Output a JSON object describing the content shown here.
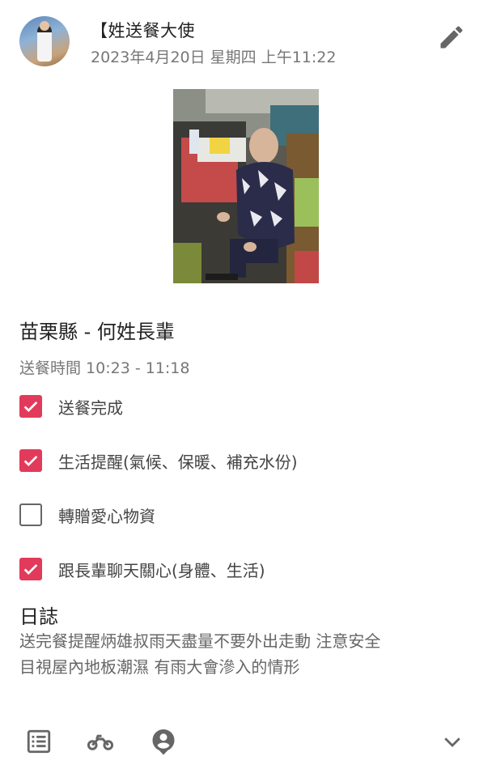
{
  "post": {
    "poster_name": "【姓送餐大使",
    "timestamp": "2023年4月20日 星期四 上午11:22"
  },
  "icons": {
    "edit": "pencil-icon",
    "list": "list-icon",
    "motorcycle": "motorcycle-icon",
    "location": "person-pin-icon",
    "expand": "chevron-down-icon"
  },
  "record": {
    "title": "苗栗縣 - 何姓長輩",
    "delivery_time": "送餐時間 10:23 - 11:18",
    "checklist": [
      {
        "label": "送餐完成",
        "checked": true
      },
      {
        "label": "生活提醒(氣候、保暖、補充水份)",
        "checked": true
      },
      {
        "label": "轉贈愛心物資",
        "checked": false
      },
      {
        "label": "跟長輩聊天關心(身體、生活)",
        "checked": true
      }
    ]
  },
  "log": {
    "heading": "日誌",
    "line1": "送完餐提醒炳雄叔雨天盡量不要外出走動 注意安全",
    "line2": "目視屋內地板潮濕 有雨大會滲入的情形"
  },
  "colors": {
    "accent": "#e23a5b",
    "unchecked_border": "#666666",
    "icon_gray": "#666666"
  }
}
